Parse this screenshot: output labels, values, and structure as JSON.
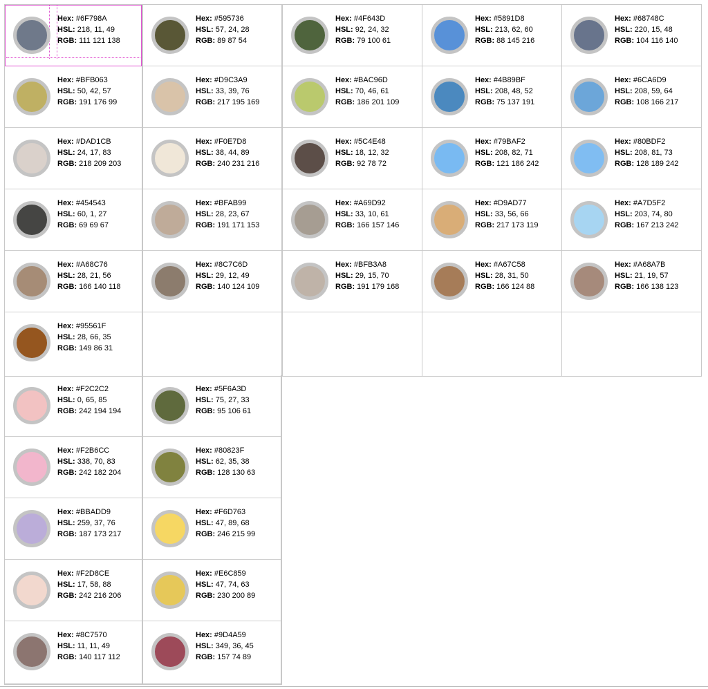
{
  "labels": {
    "hex": "Hex:",
    "hsl": "HSL:",
    "rgb": "RGB:"
  },
  "top_columns": [
    [
      {
        "hex": "#6F798A",
        "hsl": "218, 11, 49",
        "rgb": "111 121 138"
      },
      {
        "hex": "#BFB063",
        "hsl": "50, 42, 57",
        "rgb": "191 176 99"
      },
      {
        "hex": "#DAD1CB",
        "hsl": "24, 17, 83",
        "rgb": "218 209 203"
      },
      {
        "hex": "#454543",
        "hsl": "60, 1, 27",
        "rgb": "69 69 67"
      },
      {
        "hex": "#A68C76",
        "hsl": "28, 21, 56",
        "rgb": "166 140 118"
      },
      {
        "hex": "#95561F",
        "hsl": "28, 66, 35",
        "rgb": "149 86 31"
      }
    ],
    [
      {
        "hex": "#595736",
        "hsl": "57, 24, 28",
        "rgb": "89 87 54"
      },
      {
        "hex": "#D9C3A9",
        "hsl": "33, 39, 76",
        "rgb": "217 195 169"
      },
      {
        "hex": "#F0E7D8",
        "hsl": "38, 44, 89",
        "rgb": "240 231 216"
      },
      {
        "hex": "#BFAB99",
        "hsl": "28, 23, 67",
        "rgb": "191 171 153"
      },
      {
        "hex": "#8C7C6D",
        "hsl": "29, 12, 49",
        "rgb": "140 124 109"
      }
    ],
    [
      {
        "hex": "#4F643D",
        "hsl": "92, 24, 32",
        "rgb": "79 100 61"
      },
      {
        "hex": "#BAC96D",
        "hsl": "70, 46, 61",
        "rgb": "186 201 109"
      },
      {
        "hex": "#5C4E48",
        "hsl": "18, 12, 32",
        "rgb": "92 78 72"
      },
      {
        "hex": "#A69D92",
        "hsl": "33, 10, 61",
        "rgb": "166 157 146"
      },
      {
        "hex": "#BFB3A8",
        "hsl": "29, 15, 70",
        "rgb": "191 179 168"
      }
    ],
    [
      {
        "hex": "#5891D8",
        "hsl": "213, 62, 60",
        "rgb": "88 145 216"
      },
      {
        "hex": "#4B89BF",
        "hsl": "208, 48, 52",
        "rgb": "75 137 191"
      },
      {
        "hex": "#79BAF2",
        "hsl": "208, 82, 71",
        "rgb": "121 186 242"
      },
      {
        "hex": "#D9AD77",
        "hsl": "33, 56, 66",
        "rgb": "217 173 119"
      },
      {
        "hex": "#A67C58",
        "hsl": "28, 31, 50",
        "rgb": "166 124 88"
      }
    ],
    [
      {
        "hex": "#68748C",
        "hsl": "220, 15, 48",
        "rgb": "104 116 140"
      },
      {
        "hex": "#6CA6D9",
        "hsl": "208, 59, 64",
        "rgb": "108 166 217"
      },
      {
        "hex": "#80BDF2",
        "hsl": "208, 81, 73",
        "rgb": "128 189 242"
      },
      {
        "hex": "#A7D5F2",
        "hsl": "203, 74, 80",
        "rgb": "167 213 242"
      },
      {
        "hex": "#A68A7B",
        "hsl": "21, 19, 57",
        "rgb": "166 138 123"
      }
    ]
  ],
  "bottom_columns": [
    [
      {
        "hex": "#F2C2C2",
        "hsl": "0, 65, 85",
        "rgb": "242 194 194"
      },
      {
        "hex": "#F2B6CC",
        "hsl": "338, 70, 83",
        "rgb": "242 182 204"
      },
      {
        "hex": "#BBADD9",
        "hsl": "259, 37, 76",
        "rgb": "187 173 217"
      },
      {
        "hex": "#F2D8CE",
        "hsl": "17, 58, 88",
        "rgb": "242 216 206"
      },
      {
        "hex": "#8C7570",
        "hsl": "11, 11, 49",
        "rgb": "140 117 112"
      }
    ],
    [
      {
        "hex": "#5F6A3D",
        "hsl": "75, 27, 33",
        "rgb": "95 106 61"
      },
      {
        "hex": "#80823F",
        "hsl": "62, 35, 38",
        "rgb": "128 130 63"
      },
      {
        "hex": "#F6D763",
        "hsl": "47, 89, 68",
        "rgb": "246 215 99"
      },
      {
        "hex": "#E6C859",
        "hsl": "47, 74, 63",
        "rgb": "230 200 89"
      },
      {
        "hex": "#9D4A59",
        "hsl": "349, 36, 45",
        "rgb": "157 74 89"
      }
    ]
  ]
}
